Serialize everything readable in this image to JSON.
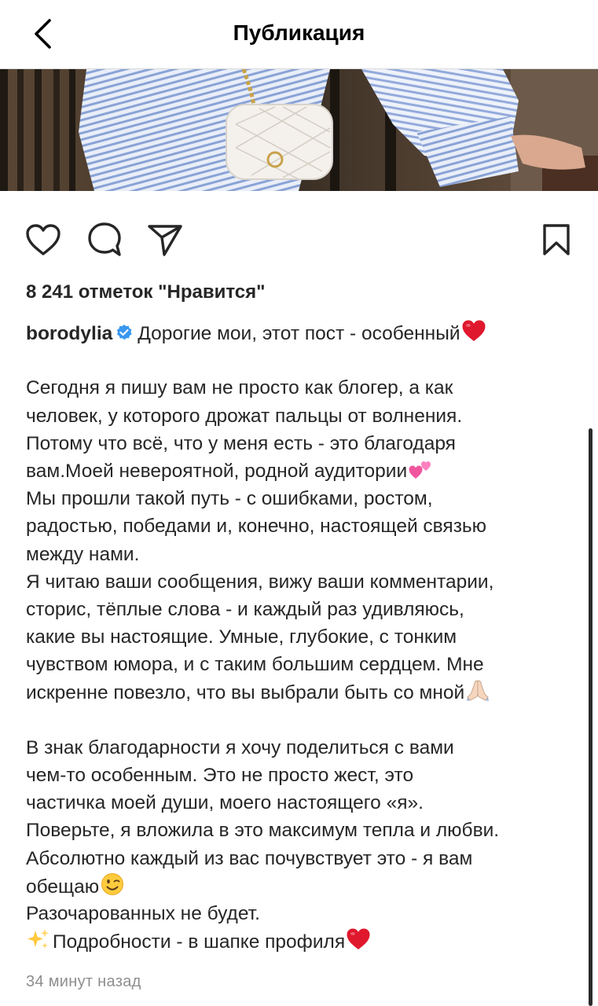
{
  "header": {
    "title": "Публикация",
    "back_icon": "chevron-left-icon"
  },
  "post": {
    "likes_text": "8 241 отметок \"Нравится\"",
    "username": "borodylia",
    "verified": true,
    "caption_lines": [
      {
        "text": "Дорогие мои, этот пост - особенный",
        "emoji": "red-heart"
      },
      {
        "text": "",
        "blank": true
      },
      {
        "text": "Сегодня я пишу вам не просто как блогер, а как"
      },
      {
        "text": "человек, у которого дрожат пальцы от волнения."
      },
      {
        "text": "Потому что всё, что у меня есть - это благодаря"
      },
      {
        "text": "вам.Моей невероятной, родной аудитории",
        "emoji": "two-hearts"
      },
      {
        "text": "Мы прошли такой путь - с ошибками, ростом,"
      },
      {
        "text": "радостью, победами и, конечно, настоящей связью"
      },
      {
        "text": "между нами."
      },
      {
        "text": "Я читаю ваши сообщения, вижу ваши комментарии,"
      },
      {
        "text": "сторис, тёплые слова - и каждый раз удивляюсь,"
      },
      {
        "text": "какие вы настоящие. Умные, глубокие, с тонким"
      },
      {
        "text": "чувством юмора, и с таким большим сердцем. Мне"
      },
      {
        "text": "искренне повезло, что вы выбрали быть со мной",
        "emoji": "folded-hands"
      },
      {
        "text": "",
        "blank": true
      },
      {
        "text": "В знак благодарности я хочу поделиться с вами"
      },
      {
        "text": "чем-то особенным. Это не просто жест, это"
      },
      {
        "text": "частичка моей души, моего настоящего «я»."
      },
      {
        "text": "Поверьте, я вложила в это максимум тепла и любви."
      },
      {
        "text": "Абсолютно каждый из вас почувствует это - я вам"
      },
      {
        "text": "обещаю",
        "emoji": "winking-face"
      },
      {
        "text": "Разочарованных не будет."
      },
      {
        "text": "Подробности - в шапке профиля",
        "emoji": "red-heart",
        "prefix_emoji": "sparkles"
      }
    ],
    "time_ago": "34 минут назад"
  },
  "actions": {
    "like_icon": "heart-icon",
    "comment_icon": "comment-icon",
    "share_icon": "send-icon",
    "save_icon": "bookmark-icon"
  },
  "colors": {
    "text": "#262626",
    "muted": "#8e8e8e",
    "verified_blue": "#3897f0",
    "heart_red": "#e0182d",
    "border": "#dbdbdb"
  }
}
